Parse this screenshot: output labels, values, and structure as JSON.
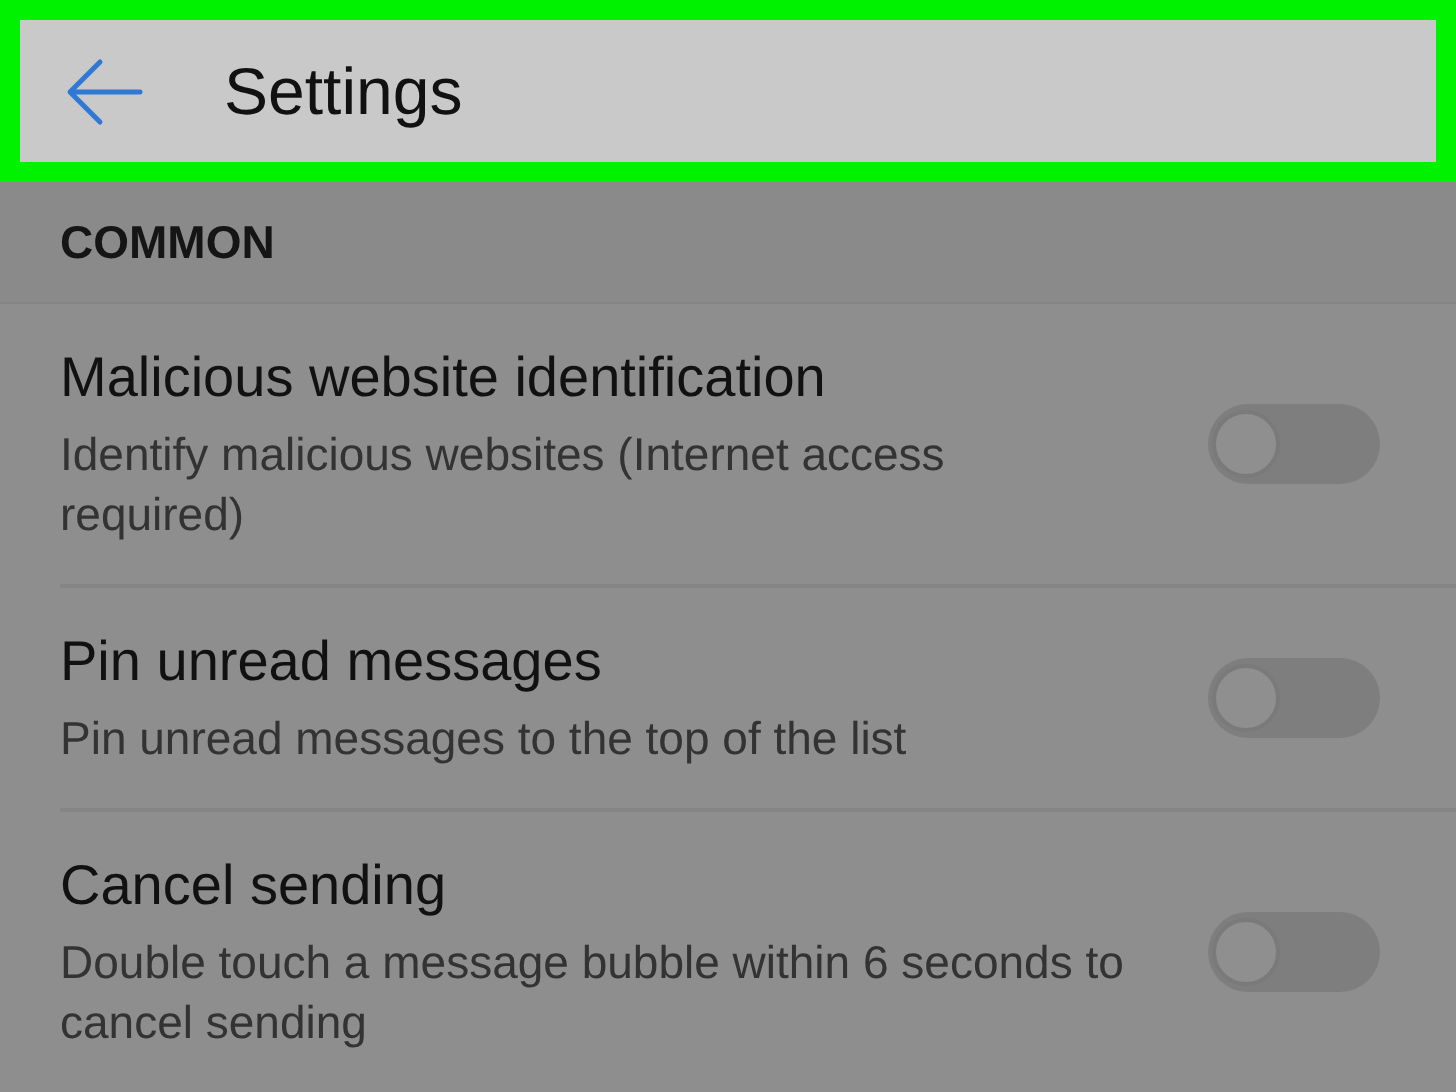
{
  "header": {
    "title": "Settings"
  },
  "section": {
    "title": "COMMON"
  },
  "items": [
    {
      "title": "Malicious website identification",
      "subtitle": "Identify malicious websites (Internet access required)",
      "on": false
    },
    {
      "title": "Pin unread messages",
      "subtitle": "Pin unread messages to the top of the list",
      "on": false
    },
    {
      "title": "Cancel sending",
      "subtitle": "Double touch a message bubble within 6 seconds to cancel sending",
      "on": false
    }
  ]
}
